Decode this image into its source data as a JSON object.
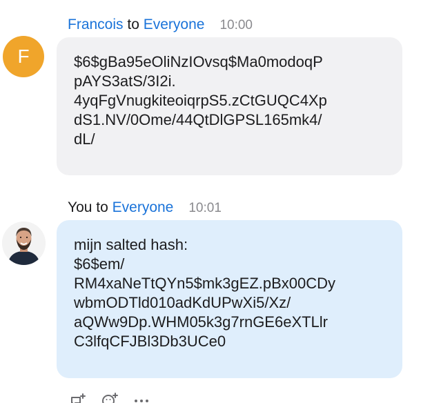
{
  "messages": [
    {
      "sender": "Francois",
      "to_word": "to",
      "recipient": "Everyone",
      "time": "10:00",
      "avatar_initial": "F",
      "lines": [
        "$6$gBa95eOliNzIOvsq$Ma0modoqP",
        "pAYS3atS/3I2i.",
        "4yqFgVnugkiteoiqrpS5.zCtGUQC4Xp",
        "dS1.NV/0Ome/44QtDlGPSL165mk4/",
        "dL/"
      ]
    },
    {
      "sender": "You",
      "to_word": "to",
      "recipient": "Everyone",
      "time": "10:01",
      "avatar": "profile-photo",
      "lines": [
        "mijn salted hash:",
        "$6$em/",
        "RM4xaNeTtQYn5$mk3gEZ.pBx00CDy",
        "wbmODTld010adKdUPwXi5/Xz/",
        "aQWw9Dp.WHM05k3g7rnGE6eXTLlr",
        "C3lfqCFJBl3Db3UCe0"
      ]
    }
  ],
  "colors": {
    "name_link": "#1a73d9",
    "time": "#8a8a8e",
    "bubble_grey": "#f1f1f3",
    "bubble_blue": "#dfeefc",
    "avatar_orange": "#f0a52b"
  },
  "actions": [
    {
      "icon": "add-reply-icon"
    },
    {
      "icon": "add-reaction-icon"
    },
    {
      "icon": "more-icon"
    }
  ]
}
